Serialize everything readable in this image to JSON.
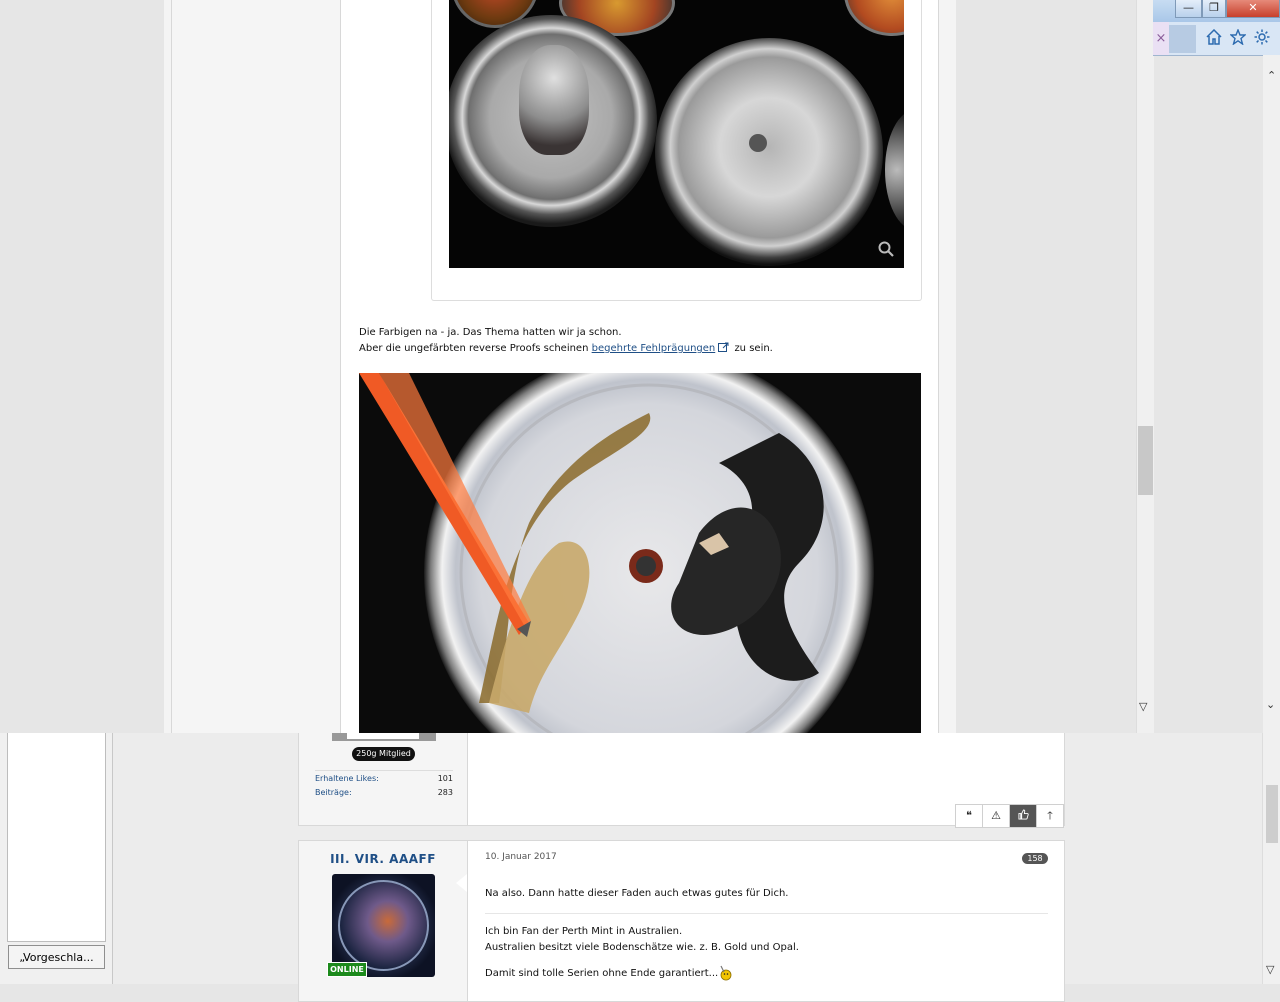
{
  "background_window": {
    "suggest_button_label": "„Vorgeschla...",
    "post_a": {
      "rank_badge": "250g Mitglied",
      "stats": [
        {
          "label": "Erhaltene Likes:",
          "value": "101"
        },
        {
          "label": "Beiträge:",
          "value": "283"
        }
      ],
      "actions": [
        {
          "name": "quote-icon",
          "glyph": "❝"
        },
        {
          "name": "report-icon",
          "glyph": "⚠"
        },
        {
          "name": "like-icon",
          "glyph": "👍"
        },
        {
          "name": "top-icon",
          "glyph": "↑"
        }
      ]
    },
    "post_b": {
      "username": "III. VIR. AAAFF",
      "online_badge": "ONLINE",
      "date": "10. Januar 2017",
      "post_number": "158",
      "lines": [
        "Na also. Dann hatte dieser Faden auch etwas gutes für Dich.",
        "Ich bin Fan der Perth Mint in Australien.",
        "Australien besitzt viele Bodenschätze wie. z. B. Gold und Opal.",
        "Damit sind tolle Serien ohne Ende garantiert..."
      ]
    }
  },
  "foreground_window": {
    "paragraph": {
      "line1": "Die Farbigen na - ja. Das Thema hatten wir ja schon.",
      "line2_before": "Aber die ungefärbten reverse Proofs scheinen",
      "link_text": "begehrte Fehlprägungen",
      "line2_after": "zu sein."
    },
    "browser_buttons": {
      "minimize": "—",
      "restore": "❐",
      "close": "✕",
      "tab_close": "×"
    },
    "toolbar_icons": [
      "home-icon",
      "star-icon",
      "gear-icon"
    ]
  },
  "colors": {
    "link": "#1f4f86",
    "online_badge": "#1c8a1c",
    "close_button": "#c7402c"
  }
}
